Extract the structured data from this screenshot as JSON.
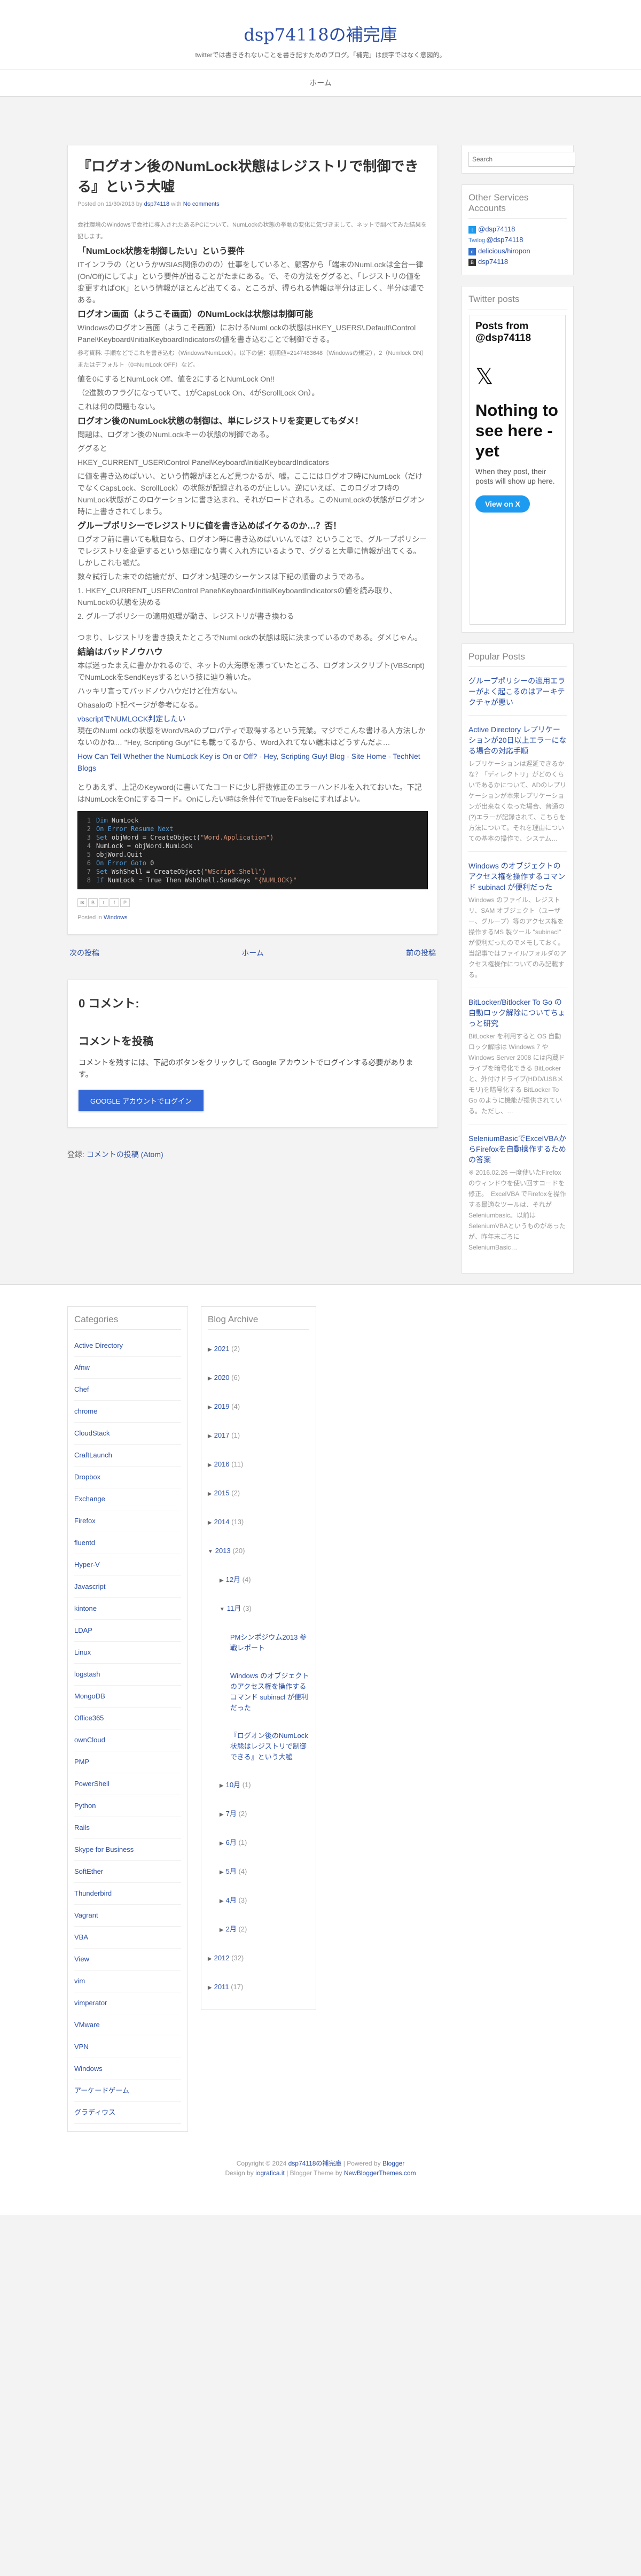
{
  "header": {
    "title": "dsp74118の補完庫",
    "description": "twitterでは書ききれないことを書き記すためのブログ。「補完」は誤字ではなく意図的。"
  },
  "nav": {
    "home": "ホーム"
  },
  "post": {
    "title": "『ログオン後のNumLock状態はレジストリで制御できる』という大嘘",
    "meta_prefix": "Posted on 11/30/2013 by",
    "author": "dsp74118",
    "meta_mid": "with",
    "comments_link": "No comments",
    "intro": "会社環境のWindowsで会社に導入されたあるPCについて、NumLockの状態の挙動の変化に気づきまして、ネットで調べてみた結果を記します。",
    "h1": "「NumLock状態を制御したい」という要件",
    "p1": "ITインフラの（というかWSIAS関係ののの）仕事をしていると、顧客から「端末のNumLockは全台一律(On/Off)にしてよ」という要件が出ることがたまにある。で、その方法をググると、「レジストリの値を変更すればOK」という情報がほとんど出てくる。ところが、得られる情報は半分は正しく、半分は嘘である。",
    "h2": "ログオン画面（ようこそ画面）のNumLockは状態は制御可能",
    "p2": "Windowsのログオン画面（ようこそ画面）におけるNumLockの状態はHKEY_USERS\\.Default\\Control Panel\\Keyboard\\InitialKeyboardIndicatorsの値を書き込むことで制御できる。",
    "p2small": "参考資料: 手順などでこれを書き込む（Windows/NumLock）。以下の値：初期値=2147483648（Windowsの規定），2（Numlock ON）またはデフォルト（0=NumLock OFF）など。",
    "p3": "値を0にするとNumLock Off、値を2にするとNumLock On!!",
    "p3b": "（2進数のフラグになっていて、1がCapsLock On、4がScrollLock On）。",
    "p3c": "これは何の問題もない。",
    "h3": "ログオン後のNumLock状態の制御は、単にレジストリを変更してもダメ！",
    "p4": "問題は、ログオン後のNumLockキーの状態の制御である。",
    "p4b": "ググると",
    "p4c": "HKEY_CURRENT_USER\\Control Panel\\Keyboard\\InitialKeyboardIndicators",
    "p4d": "に値を書き込めばいい、という情報がほとんど見つかるが、嘘。ここにはログオフ時にNumLock（だけでなくCapsLock、ScrollLock）の状態が記録されるのが正しい。逆にいえば、このログオフ時のNumLock状態がこのロケーションに書き込まれ、それがロードされる。このNumLockの状態がログオン時に上書きされてしまう。",
    "h4": "グループポリシーでレジストリに値を書き込めばイケるのか…？否！",
    "p5": "ログオフ前に書いても駄目なら、ログオン時に書き込めばいいんでは？ということで、グループポリシーでレジストリを変更するという処理になり書く入れ方にいるようで、ググると大量に情報が出てくる。しかしこれも嘘だ。",
    "p5b": "数々試行した末での結論だが、ログオン処理のシーケンスは下記の順番のようである。",
    "p5c": "1. HKEY_CURRENT_USER\\Control Panel\\Keyboard\\InitialKeyboardIndicatorsの値を読み取り、NumLockの状態を決める",
    "p5d": "2. グループポリシーの適用処理が動き、レジストリが書き換わる",
    "p5e": "つまり、レジストリを書き換えたところでNumLockの状態は既に決まっているのである。ダメじゃん。",
    "h5": "結論はバッドノウハウ",
    "p6": "本ば迷ったまえに書かかれるので、ネットの大海原を漂っていたところ、ログオンスクリプト(VBScript)でNumLockをSendKeysするという技に辿り着いた。",
    "p6b": "ハッキリ言ってバッドノウハウだけど仕方ない。",
    "p6c": "Ohasaloの下記ページが参考になる。",
    "link1": "vbscriptでNUMLOCK判定したい",
    "p7": "現在のNumLockの状態をWordVBAのプロパティで取得するという荒業。マジでこんな書ける人方法しかないのかね… \"Hey, Scripting Guy!\"にも載ってるから、Word入れてない端末はどうすんだよ…",
    "link2": "How Can Tell Whether the NumLock Key is On or Off? - Hey, Scripting Guy! Blog - Site Home - TechNet Blogs",
    "p8": "とりあえず、上記のKeyword(に書いてたコードに少し肝抜修正のエラーハンドルを入れておいた。下記はNumLockをOnにするコード。Onにしたい時は条件付でTrueをFalseにすればよい。",
    "code": [
      {
        "kw": "Dim",
        "rest": " NumLock",
        "str": ""
      },
      {
        "kw": "On Error Resume Next",
        "rest": "",
        "str": ""
      },
      {
        "kw": "Set",
        "rest": " objWord = CreateObject(",
        "str": "\"Word.Application\")"
      },
      {
        "kw": "",
        "rest": "NumLock = objWord.NumLock",
        "str": ""
      },
      {
        "kw": "",
        "rest": "objWord.Quit",
        "str": ""
      },
      {
        "kw": "On Error Goto",
        "rest": " 0",
        "str": ""
      },
      {
        "kw": "Set",
        "rest": " WshShell = CreateObject(",
        "str": "\"WScript.Shell\")"
      },
      {
        "kw": "If",
        "rest": " NumLock = True Then WshShell.SendKeys ",
        "str": "\"{NUMLOCK}\""
      }
    ],
    "labels_prefix": "Posted in",
    "label": "Windows"
  },
  "pager": {
    "newer": "次の投稿",
    "home": "ホーム",
    "older": "前の投稿"
  },
  "comments": {
    "count": "0 コメント:",
    "heading": "コメントを投稿",
    "note": "コメントを残すには、下記のボタンをクリックして Google アカウントでログインする必要があります。",
    "button": "GOOGLE アカウントでログイン",
    "subscribe_prefix": "登録:",
    "subscribe_link": "コメントの投稿 (Atom)"
  },
  "sidebar": {
    "search_placeholder": "Search",
    "accounts_title": "Other Services Accounts",
    "accounts": [
      {
        "icon": "twitter-icon",
        "glyph": "t",
        "label": "@dsp74118"
      },
      {
        "icon": "twilog-icon",
        "glyph": "T",
        "label": "@dsp74118",
        "prefix": "Twilog"
      },
      {
        "icon": "delicious-icon",
        "glyph": "d",
        "label": "delicious/hiropon"
      },
      {
        "icon": "hatena-icon",
        "glyph": "B",
        "label": "dsp74118"
      }
    ],
    "twitter_title": "Twitter posts",
    "tw_posts": "Posts from @dsp74118",
    "tw_big": "Nothing to see here - yet",
    "tw_small": "When they post, their posts will show up here.",
    "tw_btn": "View on X",
    "popular_title": "Popular Posts",
    "popular": [
      {
        "title": "グループポリシーの適用エラーがよく起こるのはアーキテクチャが悪い",
        "excerpt": ""
      },
      {
        "title": "Active Directory レプリケーションが20日以上エラーになる場合の対応手順",
        "excerpt": "レプリケーションは遅延できるかな？「ディレクトリ」がどのくらいであるかについて、ADのレプリケーションが本来レプリケーションが出来なくなった場合、普通の(?)エラーが記録されて、こちらを方法について。それを理由についての基本の操作で、システム…"
      },
      {
        "title": "Windows のオブジェクトのアクセス権を操作するコマンド subinacl が便利だった",
        "excerpt": "Windows のファイル、レジストリ、SAM オブジェクト（ユーザー、グループ）等のアクセス権を操作するMS 製ツール \"subinacl\" が便利だったのでメモしておく。当記事ではファイル/フォルダのアクセス権操作についてのみ記載する。"
      },
      {
        "title": "BitLocker/Bitlocker To Go の自動ロック解除についてちょっと研究",
        "excerpt": "BitLocker を利用すると OS 自動ロック解除は Windows 7 や Windows Server 2008 には内蔵ドライブを暗号化できる BitLocker と、外付けドライブ(HDD/USBメモリ)を暗号化する BitLocker To Go のように機能が提供されている。ただし、…"
      },
      {
        "title": "SeleniumBasicでExcelVBAからFirefoxを自動操作するための答案",
        "excerpt": "※ 2016.02.26 一度使いたFirefoxのウィンドウを使い回すコードを修正。　ExcelVBA でFirefoxを操作する最適なツールは、それがSeleniumbasic。以前はSeleniumVBAというものがあったが、昨年末ごろにSeleniumBasic…"
      }
    ]
  },
  "footer": {
    "categories_title": "Categories",
    "categories": [
      "Active Directory",
      "Afnw",
      "Chef",
      "chrome",
      "CloudStack",
      "CraftLaunch",
      "Dropbox",
      "Exchange",
      "Firefox",
      "fluentd",
      "Hyper-V",
      "Javascript",
      "kintone",
      "LDAP",
      "Linux",
      "logstash",
      "MongoDB",
      "Office365",
      "ownCloud",
      "PMP",
      "PowerShell",
      "Python",
      "Rails",
      "Skype for Business",
      "SoftEther",
      "Thunderbird",
      "Vagrant",
      "VBA",
      "View",
      "vim",
      "vimperator",
      "VMware",
      "VPN",
      "Windows",
      "アーケードゲーム",
      "グラディウス"
    ],
    "archive_title": "Blog Archive",
    "archive_years": [
      {
        "label": "2021",
        "count": "(2)"
      },
      {
        "label": "2020",
        "count": "(6)"
      },
      {
        "label": "2019",
        "count": "(4)"
      },
      {
        "label": "2017",
        "count": "(1)"
      },
      {
        "label": "2016",
        "count": "(11)"
      },
      {
        "label": "2015",
        "count": "(2)"
      },
      {
        "label": "2014",
        "count": "(13)"
      }
    ],
    "archive_2013": {
      "label": "2013",
      "count": "(20)"
    },
    "archive_dec": {
      "label": "12月",
      "count": "(4)"
    },
    "archive_nov": {
      "label": "11月",
      "count": "(3)"
    },
    "archive_nov_posts": [
      "PMシンポジウム2013 参戦レポート",
      "Windows のオブジェクトのアクセス権を操作するコマンド subinacl が便利だった",
      "『ログオン後のNumLock状態はレジストリで制御できる』という大嘘"
    ],
    "archive_months": [
      {
        "label": "10月",
        "count": "(1)"
      },
      {
        "label": "7月",
        "count": "(2)"
      },
      {
        "label": "6月",
        "count": "(1)"
      },
      {
        "label": "5月",
        "count": "(4)"
      },
      {
        "label": "4月",
        "count": "(3)"
      },
      {
        "label": "2月",
        "count": "(2)"
      }
    ],
    "archive_tail": [
      {
        "label": "2012",
        "count": "(32)"
      },
      {
        "label": "2011",
        "count": "(17)"
      }
    ],
    "copyright_prefix": "Copyright © 2024",
    "copyright_site": "dsp74118の補完庫",
    "powered": "| Powered by",
    "blogger": "Blogger",
    "design_prefix": "Design by",
    "design_link": "iografica.it",
    "theme_prefix": "| Blogger Theme by",
    "theme_link": "NewBloggerThemes.com"
  }
}
